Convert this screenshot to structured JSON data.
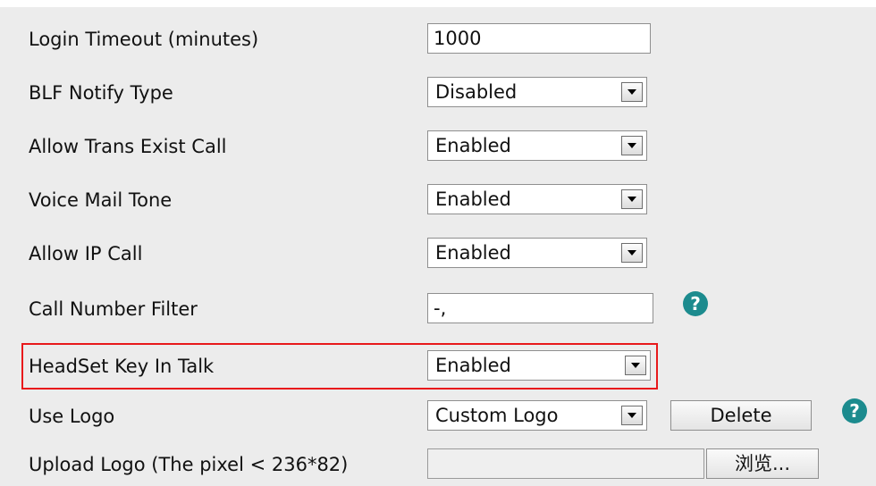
{
  "settings": {
    "login_timeout": {
      "label": "Login Timeout (minutes)",
      "value": "1000"
    },
    "blf_notify_type": {
      "label": "BLF Notify Type",
      "value": "Disabled"
    },
    "allow_trans_exist_call": {
      "label": "Allow Trans Exist Call",
      "value": "Enabled"
    },
    "voice_mail_tone": {
      "label": "Voice Mail Tone",
      "value": "Enabled"
    },
    "allow_ip_call": {
      "label": "Allow IP Call",
      "value": "Enabled"
    },
    "call_number_filter": {
      "label": "Call Number Filter",
      "value": "-,"
    },
    "headset_key_in_talk": {
      "label": "HeadSet Key In Talk",
      "value": "Enabled"
    },
    "use_logo": {
      "label": "Use Logo",
      "value": "Custom Logo",
      "delete_label": "Delete"
    },
    "upload_logo": {
      "label": "Upload Logo (The pixel < 236*82)",
      "value": "",
      "browse_label": "浏览..."
    }
  },
  "icons": {
    "help": "question-circle-icon"
  },
  "colors": {
    "help": "#1c8b8e",
    "highlight": "#e8191b"
  }
}
